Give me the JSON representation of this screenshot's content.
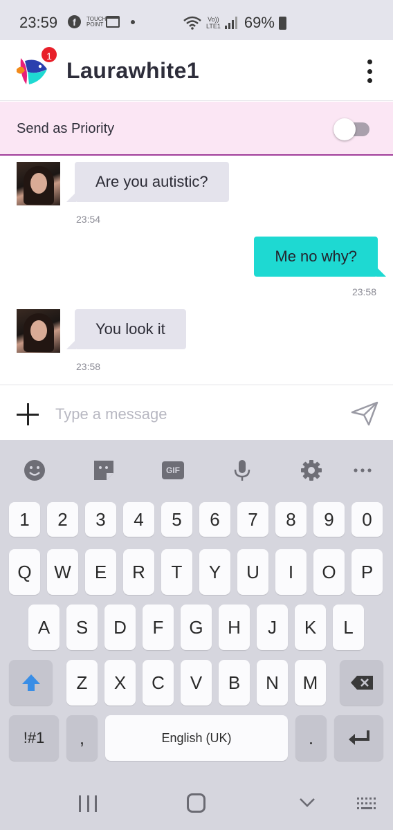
{
  "status_bar": {
    "time": "23:59",
    "battery": "69%",
    "left_icons": [
      "facebook-icon",
      "touch-point-icon",
      "calendar-icon",
      "dot-icon"
    ],
    "right_icons": [
      "wifi-icon",
      "volte-lte-icon",
      "signal-icon",
      "battery-icon"
    ],
    "lte_label_top": "Vo))",
    "lte_label_bottom": "LTE1",
    "touch_label": "TOUCH POINT"
  },
  "header": {
    "contact_name": "Laurawhite1",
    "notification_count": "1",
    "logo_icon": "fish-logo-icon",
    "menu_icon": "kebab-menu-icon"
  },
  "priority": {
    "label": "Send as Priority",
    "enabled": false
  },
  "messages": [
    {
      "direction": "incoming",
      "text": "Are you autistic?",
      "time": "23:54"
    },
    {
      "direction": "outgoing",
      "text": "Me no why?",
      "time": "23:58"
    },
    {
      "direction": "incoming",
      "text": "You look it",
      "time": "23:58"
    }
  ],
  "composer": {
    "placeholder": "Type a message",
    "value": ""
  },
  "keyboard": {
    "toolbar": [
      "emoji-icon",
      "sticker-icon",
      "gif-icon",
      "microphone-icon",
      "settings-icon",
      "more-icon"
    ],
    "gif_label": "GIF",
    "number_row": [
      "1",
      "2",
      "3",
      "4",
      "5",
      "6",
      "7",
      "8",
      "9",
      "0"
    ],
    "row1": [
      "Q",
      "W",
      "E",
      "R",
      "T",
      "Y",
      "U",
      "I",
      "O",
      "P"
    ],
    "row2": [
      "A",
      "S",
      "D",
      "F",
      "G",
      "H",
      "J",
      "K",
      "L"
    ],
    "row3": [
      "Z",
      "X",
      "C",
      "V",
      "B",
      "N",
      "M"
    ],
    "symbols_label": "!#1",
    "comma_label": ",",
    "space_label": "English (UK)",
    "period_label": "."
  },
  "colors": {
    "outgoing_bubble": "#1ed9d2",
    "incoming_bubble": "#e4e3ec",
    "priority_bg": "#fbe6f4",
    "priority_border": "#a03c9a",
    "badge": "#e8202a",
    "shift_arrow": "#3a8ee6"
  }
}
